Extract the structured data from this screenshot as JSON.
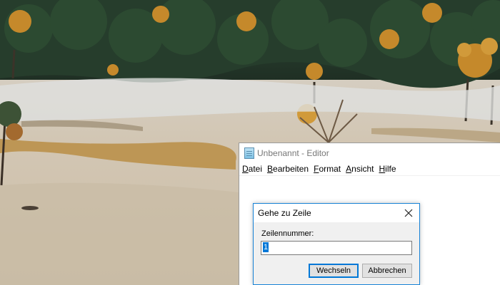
{
  "notepad": {
    "title": "Unbenannt - Editor",
    "menu": [
      {
        "label": "Datei",
        "accel": "D",
        "rest": "atei"
      },
      {
        "label": "Bearbeiten",
        "accel": "B",
        "rest": "earbeiten"
      },
      {
        "label": "Format",
        "accel": "F",
        "rest": "ormat"
      },
      {
        "label": "Ansicht",
        "accel": "A",
        "rest": "nsicht"
      },
      {
        "label": "Hilfe",
        "accel": "H",
        "rest": "ilfe"
      }
    ],
    "icon": "notepad-icon"
  },
  "goto_dialog": {
    "title": "Gehe zu Zeile",
    "label": "Zeilennummer:",
    "line_value": "1",
    "ok_label": "Wechseln",
    "cancel_label": "Abbrechen",
    "close_icon": "close-icon",
    "accent": "#0078d7"
  },
  "wallpaper": {
    "description_icon": "landscape-wallpaper"
  }
}
